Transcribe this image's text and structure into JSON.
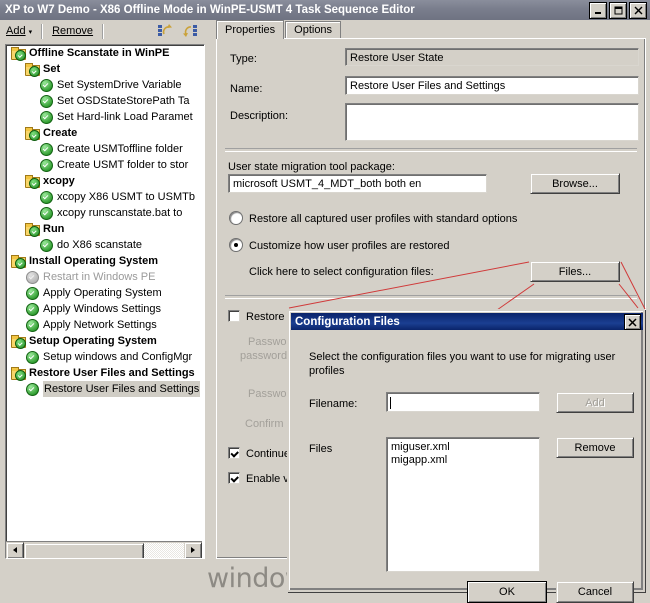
{
  "window": {
    "title": "XP to W7 Demo - X86 Offline Mode in WinPE-USMT 4 Task Sequence Editor",
    "minimize_label": "_",
    "maximize_label": "□",
    "close_label": "✕"
  },
  "toolbar": {
    "add_label": "Add",
    "add_arrow": "▾",
    "remove_label": "Remove",
    "icon_move_up": "move-up-icon",
    "icon_move_down": "move-down-icon"
  },
  "tree": {
    "items": [
      {
        "label": "Offline Scanstate in WinPE",
        "indent": 0,
        "type": "folder",
        "bold": true,
        "state": "enabled",
        "selected": false
      },
      {
        "label": "Set",
        "indent": 1,
        "type": "folder",
        "bold": true,
        "state": "enabled",
        "selected": false
      },
      {
        "label": "Set SystemDrive Variable",
        "indent": 2,
        "type": "step",
        "bold": false,
        "state": "enabled",
        "selected": false
      },
      {
        "label": "Set OSDStateStorePath Ta",
        "indent": 2,
        "type": "step",
        "bold": false,
        "state": "enabled",
        "selected": false
      },
      {
        "label": "Set Hard-link Load Paramet",
        "indent": 2,
        "type": "step",
        "bold": false,
        "state": "enabled",
        "selected": false
      },
      {
        "label": "Create",
        "indent": 1,
        "type": "folder",
        "bold": true,
        "state": "enabled",
        "selected": false
      },
      {
        "label": "Create USMToffline folder",
        "indent": 2,
        "type": "step",
        "bold": false,
        "state": "enabled",
        "selected": false
      },
      {
        "label": "Create USMT folder to stor",
        "indent": 2,
        "type": "step",
        "bold": false,
        "state": "enabled",
        "selected": false
      },
      {
        "label": "xcopy",
        "indent": 1,
        "type": "folder",
        "bold": true,
        "state": "enabled",
        "selected": false
      },
      {
        "label": "xcopy X86 USMT to USMTb",
        "indent": 2,
        "type": "step",
        "bold": false,
        "state": "enabled",
        "selected": false
      },
      {
        "label": "xcopy runscanstate.bat to",
        "indent": 2,
        "type": "step",
        "bold": false,
        "state": "enabled",
        "selected": false
      },
      {
        "label": "Run",
        "indent": 1,
        "type": "folder",
        "bold": true,
        "state": "enabled",
        "selected": false
      },
      {
        "label": "do X86 scanstate",
        "indent": 2,
        "type": "step",
        "bold": false,
        "state": "enabled",
        "selected": false
      },
      {
        "label": "Install Operating System",
        "indent": 0,
        "type": "folder",
        "bold": true,
        "state": "enabled",
        "selected": false
      },
      {
        "label": "Restart in Windows PE",
        "indent": 1,
        "type": "step",
        "bold": false,
        "state": "disabled",
        "selected": false
      },
      {
        "label": "Apply Operating System",
        "indent": 1,
        "type": "step",
        "bold": false,
        "state": "enabled",
        "selected": false
      },
      {
        "label": "Apply Windows Settings",
        "indent": 1,
        "type": "step",
        "bold": false,
        "state": "enabled",
        "selected": false
      },
      {
        "label": "Apply Network Settings",
        "indent": 1,
        "type": "step",
        "bold": false,
        "state": "enabled",
        "selected": false
      },
      {
        "label": "Setup Operating System",
        "indent": 0,
        "type": "folder",
        "bold": true,
        "state": "enabled",
        "selected": false
      },
      {
        "label": "Setup windows and ConfigMgr",
        "indent": 1,
        "type": "step",
        "bold": false,
        "state": "enabled",
        "selected": false
      },
      {
        "label": "Restore User Files and Settings",
        "indent": 0,
        "type": "folder",
        "bold": true,
        "state": "enabled",
        "selected": false
      },
      {
        "label": "Restore User Files and Settings",
        "indent": 1,
        "type": "step",
        "bold": false,
        "state": "enabled",
        "selected": true
      }
    ]
  },
  "tabs": [
    {
      "label": "Properties",
      "active": true
    },
    {
      "label": "Options",
      "active": false
    }
  ],
  "properties": {
    "type_label": "Type:",
    "type_value": "Restore User State",
    "name_label": "Name:",
    "name_value": "Restore User Files and Settings",
    "description_label": "Description:",
    "description_value": "",
    "usmt_package_label": "User state migration tool package:",
    "usmt_package_value": "microsoft USMT_4_MDT_both both en",
    "browse_label": "Browse...",
    "radio_standard_label": "Restore all captured user profiles with standard options",
    "radio_standard_selected": false,
    "radio_custom_label": "Customize how user profiles are restored",
    "radio_custom_selected": true,
    "config_files_hint": "Click here to select configuration files:",
    "files_button_label": "Files...",
    "restore_checkbox_label": "Restore l",
    "restore_checkbox_checked": false,
    "password_note_line1": "Password",
    "password_note_line2": "password",
    "password_label": "Password",
    "confirm_password_label": "Confirm P",
    "continue_checkbox_label": "Continue",
    "continue_checkbox_checked": true,
    "verbose_checkbox_label": "Enable ve",
    "verbose_checkbox_checked": true
  },
  "dialog": {
    "title": "Configuration Files",
    "close_label": "✕",
    "instruction": "Select the configuration files you want to use for migrating user profiles",
    "filename_label": "Filename:",
    "filename_value": "",
    "add_label": "Add",
    "add_disabled": true,
    "files_label": "Files",
    "files_list": [
      "miguser.xml",
      "migapp.xml"
    ],
    "remove_label": "Remove",
    "ok_label": "OK",
    "cancel_label": "Cancel"
  },
  "watermark": {
    "text": "windows-noob.com"
  },
  "colors": {
    "window_face": "#d4d0c8",
    "dialog_titlebar": "#0a246a",
    "main_titlebar": "#7b7f8e",
    "annotation": "#d03a3a",
    "selection": "#d0cdc5"
  }
}
